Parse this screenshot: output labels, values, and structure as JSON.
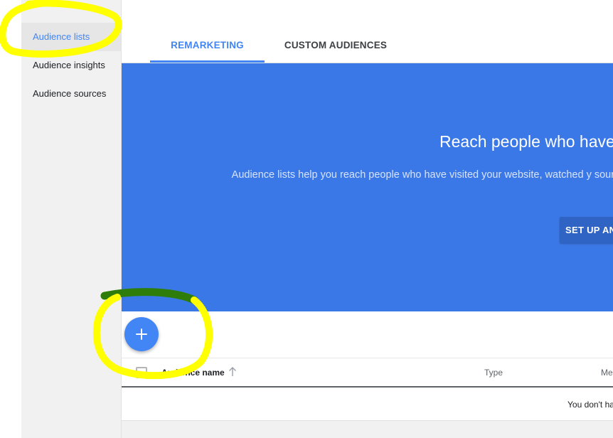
{
  "sidebar": {
    "items": [
      {
        "label": "Audience lists",
        "active": true
      },
      {
        "label": "Audience insights",
        "active": false
      },
      {
        "label": "Audience sources",
        "active": false
      }
    ]
  },
  "tabs": [
    {
      "label": "REMARKETING",
      "active": true
    },
    {
      "label": "CUSTOM AUDIENCES",
      "active": false
    }
  ],
  "hero": {
    "title": "Reach people who have",
    "description": "Audience lists help you reach people who have visited your website, watched y source to reach the right people, w",
    "button_label": "SET UP AN"
  },
  "fab": {
    "icon": "plus-icon"
  },
  "table": {
    "columns": [
      "Audience name",
      "Type",
      "Me"
    ],
    "sort_icon": "arrow-up-icon",
    "empty_message": "You don't ha"
  },
  "colors": {
    "accent": "#4285f4",
    "hero_background": "#3b78e7",
    "highlighter_yellow": "#ffff00",
    "highlighter_green": "#2e7d0a"
  }
}
